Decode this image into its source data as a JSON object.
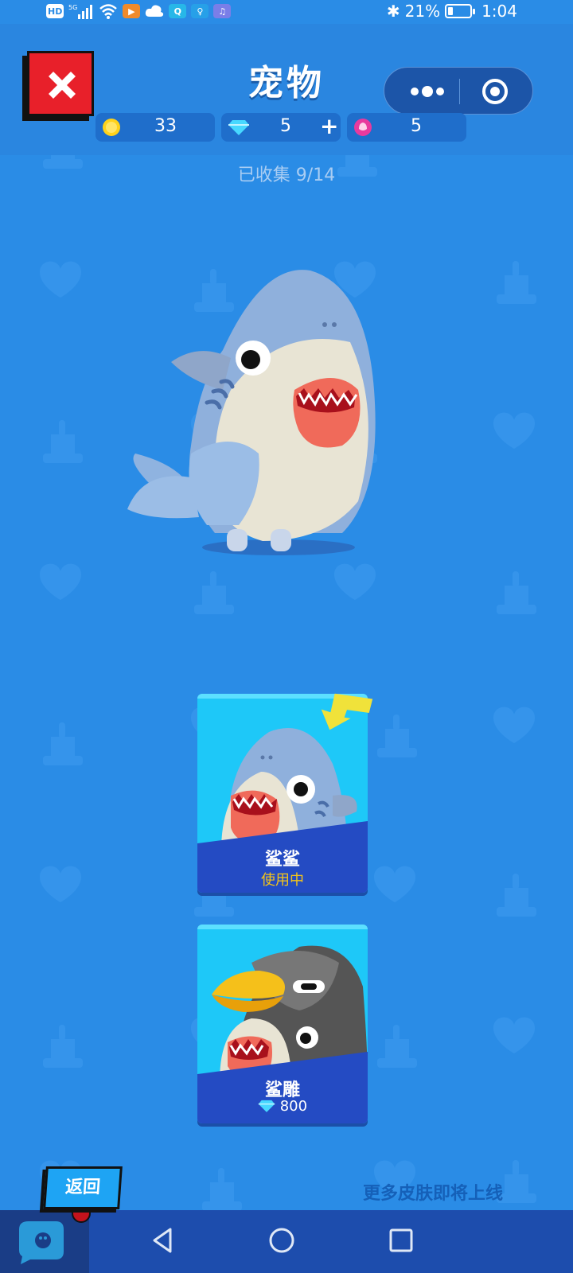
{
  "status_bar": {
    "left_icons": [
      "hd-icon",
      "signal-5g-icon",
      "wifi-icon",
      "video-app-icon",
      "cloud-icon",
      "search-app-icon",
      "bulb-app-icon",
      "music-app-icon"
    ],
    "hd_label": "HD",
    "battery": "21%",
    "time": "1:04"
  },
  "header": {
    "title": "宠物",
    "close_icon": "close-icon",
    "capsule": {
      "more_icon": "more-dots-icon",
      "target_icon": "target-icon"
    }
  },
  "currencies": {
    "coins": "33",
    "diamonds": "5",
    "add_symbol": "+",
    "tokens": "5"
  },
  "collection": {
    "collected_text": "已收集 9/14"
  },
  "skins": [
    {
      "name": "鲨鲨",
      "status": "使用中",
      "selected": true
    },
    {
      "name": "鲨雕",
      "price": "800",
      "price_icon": "diamond-icon"
    }
  ],
  "footer": {
    "back_label": "返回",
    "more_skins_text": "更多皮肤即将上线"
  },
  "colors": {
    "background": "#2a8ce6",
    "close_red": "#e8202a",
    "card_cyan": "#1ec8f8",
    "card_band": "#244bc3",
    "status_in_use": "#f5c518"
  }
}
